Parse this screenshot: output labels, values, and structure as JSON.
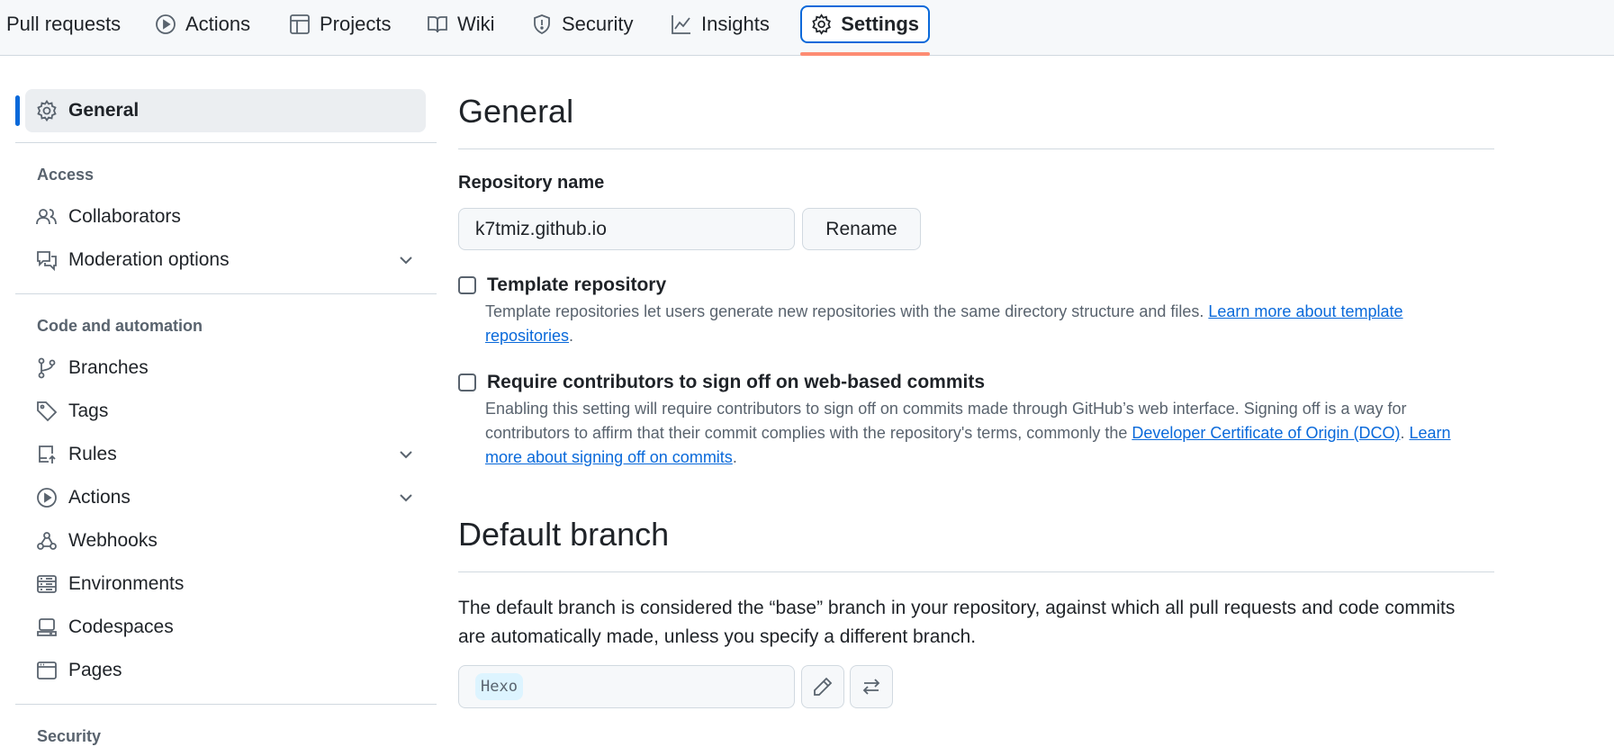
{
  "topnav": {
    "tabs": [
      {
        "label": "Pull requests",
        "icon": "pull-request-icon"
      },
      {
        "label": "Actions",
        "icon": "play-icon"
      },
      {
        "label": "Projects",
        "icon": "table-icon"
      },
      {
        "label": "Wiki",
        "icon": "book-icon"
      },
      {
        "label": "Security",
        "icon": "shield-icon"
      },
      {
        "label": "Insights",
        "icon": "graph-icon"
      },
      {
        "label": "Settings",
        "icon": "gear-icon",
        "active": true
      }
    ]
  },
  "sidebar": {
    "active": {
      "label": "General",
      "icon": "gear-icon"
    },
    "headings": {
      "access": "Access",
      "code": "Code and automation",
      "security": "Security"
    },
    "items": [
      {
        "label": "Collaborators",
        "icon": "people-icon"
      },
      {
        "label": "Moderation options",
        "icon": "comment-discussion-icon",
        "expandable": true
      },
      {
        "label": "Branches",
        "icon": "git-branch-icon"
      },
      {
        "label": "Tags",
        "icon": "tag-icon"
      },
      {
        "label": "Rules",
        "icon": "repo-push-icon",
        "expandable": true
      },
      {
        "label": "Actions",
        "icon": "play-icon",
        "expandable": true
      },
      {
        "label": "Webhooks",
        "icon": "webhook-icon"
      },
      {
        "label": "Environments",
        "icon": "server-icon"
      },
      {
        "label": "Codespaces",
        "icon": "codespaces-icon"
      },
      {
        "label": "Pages",
        "icon": "browser-icon"
      }
    ]
  },
  "main": {
    "general_title": "General",
    "repo_name_label": "Repository name",
    "repo_name_value": "k7tmiz.github.io",
    "rename_label": "Rename",
    "template": {
      "label": "Template repository",
      "desc": "Template repositories let users generate new repositories with the same directory structure and files.",
      "link": "Learn more about template repositories",
      "after": "."
    },
    "signoff": {
      "label": "Require contributors to sign off on web-based commits",
      "desc": "Enabling this setting will require contributors to sign off on commits made through GitHub’s web interface. Signing off is a way for contributors to affirm that their commit complies with the repository's terms, commonly the",
      "link1": "Developer Certificate of Origin (DCO)",
      "mid": ".",
      "link2": "Learn more about signing off on commits",
      "after": "."
    },
    "default_branch_title": "Default branch",
    "default_branch_desc": "The default branch is considered the “base” branch in your repository, against which all pull requests and code commits are automatically made, unless you specify a different branch.",
    "default_branch_value": "Hexo"
  },
  "colors": {
    "accent": "#0969da",
    "tab_underline": "#fd8c73"
  }
}
